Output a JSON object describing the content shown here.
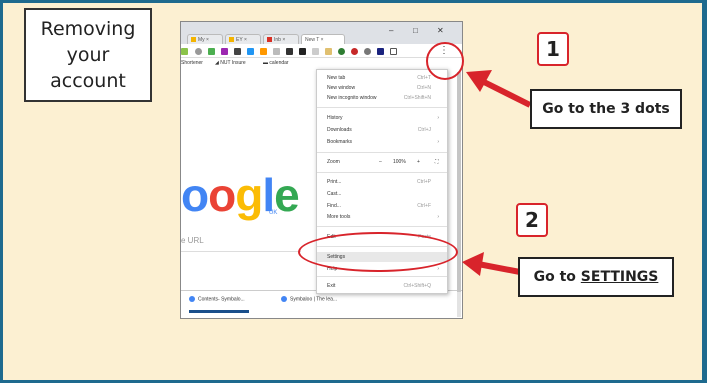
{
  "title": {
    "line1": "Removing",
    "line2": "your",
    "line3": "account"
  },
  "browser": {
    "tabs": [
      "My",
      "EY",
      "Inb",
      "New T"
    ],
    "bookmarks": [
      "Shortener",
      "NUT Insure",
      "calendar"
    ],
    "google_text": "oogle",
    "google_region": "UK",
    "omnibox_placeholder": "e URL",
    "bottom_tabs": [
      "Contents- Symbalo...",
      "Symbaloo | The lea..."
    ]
  },
  "menu": {
    "items": [
      {
        "label": "New tab",
        "shortcut": "Ctrl+T"
      },
      {
        "label": "New window",
        "shortcut": "Ctrl+N"
      },
      {
        "label": "New incognito window",
        "shortcut": "Ctrl+Shift+N"
      },
      {
        "label": "History",
        "shortcut": ""
      },
      {
        "label": "Downloads",
        "shortcut": "Ctrl+J"
      },
      {
        "label": "Bookmarks",
        "shortcut": ""
      },
      {
        "label": "Zoom",
        "shortcut": ""
      },
      {
        "label": "Print...",
        "shortcut": "Ctrl+P"
      },
      {
        "label": "Cast...",
        "shortcut": ""
      },
      {
        "label": "Find...",
        "shortcut": "Ctrl+F"
      },
      {
        "label": "More tools",
        "shortcut": ""
      },
      {
        "label": "Edit",
        "shortcut": "Paste"
      },
      {
        "label": "Settings",
        "shortcut": ""
      },
      {
        "label": "Help",
        "shortcut": ""
      },
      {
        "label": "Exit",
        "shortcut": "Ctrl+Shift+Q"
      }
    ],
    "zoom_minus": "–",
    "zoom_value": "100%",
    "zoom_plus": "+",
    "zoom_full": "⛶"
  },
  "steps": [
    {
      "number": "1",
      "text": "Go to the 3 dots"
    },
    {
      "number": "2",
      "text_prefix": "Go to ",
      "text_underlined": "SETTINGS"
    }
  ],
  "colors": {
    "frame": "#1e6a8e",
    "background": "#fcf0d2",
    "accent_red": "#d8242b"
  }
}
